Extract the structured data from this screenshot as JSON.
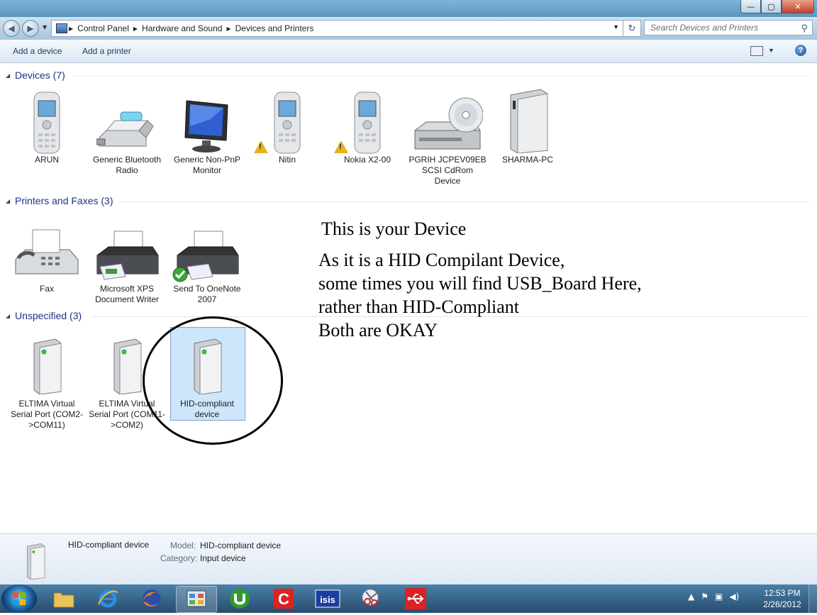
{
  "window": {
    "buttons": {
      "minimize": "—",
      "maximize": "▢",
      "close": "✕"
    }
  },
  "address": {
    "crumbs": [
      "Control Panel",
      "Hardware and Sound",
      "Devices and Printers"
    ],
    "search_placeholder": "Search Devices and Printers"
  },
  "commands": {
    "add_device": "Add a device",
    "add_printer": "Add a printer",
    "help": "?"
  },
  "groups": {
    "devices": {
      "title": "Devices (7)",
      "items": [
        {
          "label": "ARUN",
          "icon": "mobile-phone-icon"
        },
        {
          "label": "Generic Bluetooth Radio",
          "icon": "bluetooth-dongle-icon"
        },
        {
          "label": "Generic Non-PnP Monitor",
          "icon": "monitor-icon"
        },
        {
          "label": "Nitin",
          "icon": "mobile-phone-icon",
          "warning": true
        },
        {
          "label": "Nokia X2-00",
          "icon": "mobile-phone-icon",
          "warning": true
        },
        {
          "label": "PGRIH JCPEV09EB SCSI CdRom Device",
          "icon": "cdrom-drive-icon"
        },
        {
          "label": "SHARMA-PC",
          "icon": "computer-tower-icon"
        }
      ]
    },
    "printers": {
      "title": "Printers and Faxes (3)",
      "items": [
        {
          "label": "Fax",
          "icon": "fax-icon"
        },
        {
          "label": "Microsoft XPS Document Writer",
          "icon": "printer-icon"
        },
        {
          "label": "Send To OneNote 2007",
          "icon": "printer-icon",
          "default": true
        }
      ]
    },
    "unspecified": {
      "title": "Unspecified (3)",
      "items": [
        {
          "label": "ELTIMA Virtual Serial Port (COM2->COM11)",
          "icon": "generic-device-icon"
        },
        {
          "label": "ELTIMA Virtual Serial Port (COM11->COM2)",
          "icon": "generic-device-icon"
        },
        {
          "label": "HID-compliant device",
          "icon": "generic-device-icon",
          "selected": true
        }
      ]
    }
  },
  "annotation": {
    "title": "This is your Device",
    "lines": [
      "As it is a HID Compilant Device,",
      "some times you will find USB_Board Here,",
      "rather than HID-Compliant",
      "Both are OKAY"
    ]
  },
  "details": {
    "name": "HID-compliant device",
    "model_key": "Model:",
    "model_value": "HID-compliant device",
    "category_key": "Category:",
    "category_value": "Input device"
  },
  "taskbar": {
    "clock_time": "12:53 PM",
    "clock_date": "2/26/2012",
    "tb_text_c": "C",
    "tb_text_isis": "isis"
  },
  "colors": {
    "accent": "#1e3287",
    "selection": "#cde6fb",
    "warning": "#e8b21b"
  }
}
